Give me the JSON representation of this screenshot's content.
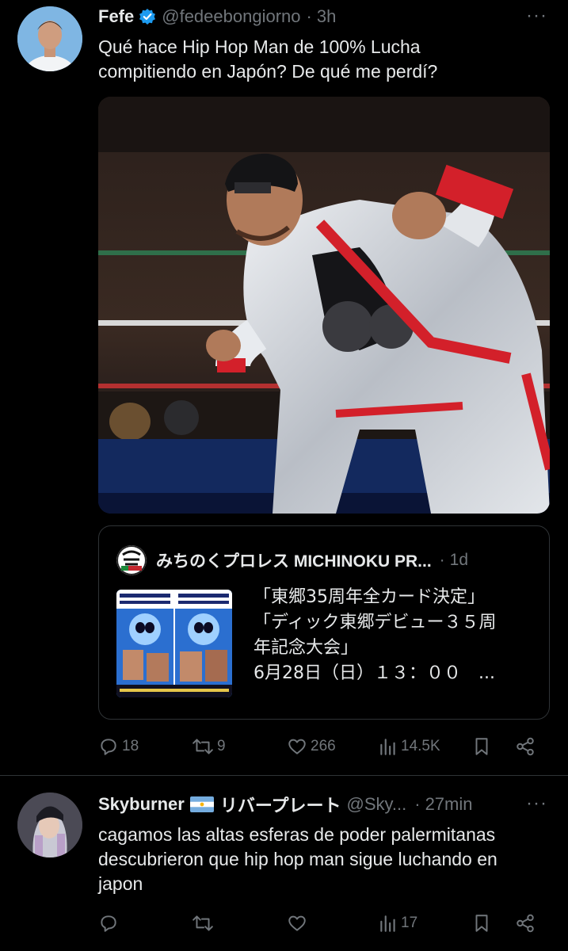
{
  "tweet1": {
    "name": "Fefe",
    "handle": "@fedeebongiorno",
    "sep": "·",
    "time": "3h",
    "more": "···",
    "text_line1": "Qué hace Hip Hop Man de 100% Lucha",
    "text_line2": "compitiendo en Japón? De qué me perdí?",
    "quote": {
      "name": "みちのくプロレス MICHINOKU PR...",
      "sep": "·",
      "time": "1d",
      "line1": "「東郷35周年全カード決定」",
      "line2": "「ディック東郷デビュー３５周",
      "line3": "年記念大会」",
      "line4": "6月28日（日）１３：００　..."
    },
    "actions": {
      "replies": "18",
      "reposts": "9",
      "likes": "266",
      "views": "14.5K"
    }
  },
  "tweet2": {
    "name": "Skyburner",
    "flag": "argentina-flag",
    "name_jp": "リバープレート",
    "handle": "@Sky...",
    "sep": "·",
    "time": "27min",
    "more": "···",
    "text_line1": "cagamos las altas esferas de poder palermitanas",
    "text_line2": "descubrieron que hip hop man sigue luchando en",
    "text_line3": "japon",
    "actions": {
      "views": "17"
    }
  },
  "colors": {
    "background": "#000000",
    "text": "#e7e9ea",
    "muted": "#71767b",
    "border": "#2f3336",
    "verified": "#1d9bf0"
  }
}
